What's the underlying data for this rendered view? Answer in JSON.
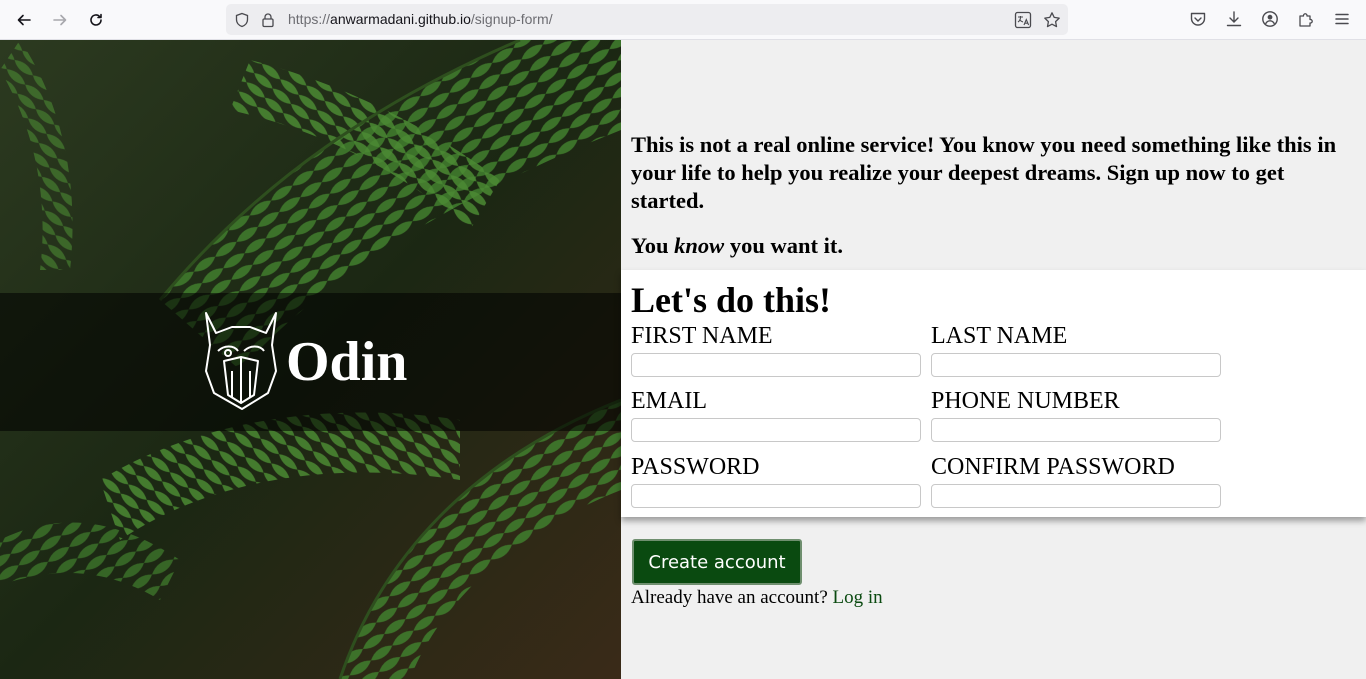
{
  "browser": {
    "url_scheme": "https://",
    "url_host": "anwarmadani.github.io",
    "url_path": "/signup-form/"
  },
  "hero": {
    "brand": "Odin"
  },
  "intro": {
    "text": "This is not a real online service! You know you need something like this in your life to help you realize your deepest dreams. Sign up now to get started.",
    "you": "You ",
    "know": "know",
    "want": " you want it."
  },
  "form": {
    "title": "Let's do this!",
    "fields": [
      {
        "label": "FIRST NAME",
        "value": ""
      },
      {
        "label": "LAST NAME",
        "value": ""
      },
      {
        "label": "EMAIL",
        "value": ""
      },
      {
        "label": "PHONE NUMBER",
        "value": ""
      },
      {
        "label": "PASSWORD",
        "value": ""
      },
      {
        "label": "CONFIRM PASSWORD",
        "value": ""
      }
    ]
  },
  "actions": {
    "create_label": "Create account",
    "login_prompt": "Already have an account? ",
    "login_link": "Log in"
  },
  "colors": {
    "accent": "#0a4a10",
    "page_bg": "#f0f0f0"
  }
}
